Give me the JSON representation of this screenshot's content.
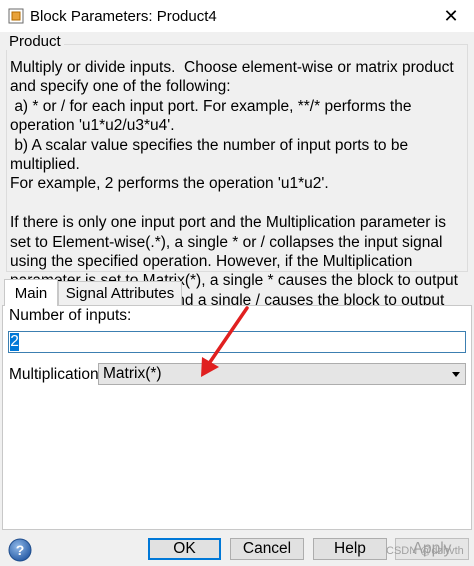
{
  "window": {
    "title": "Block Parameters: Product4",
    "close_glyph": "✕"
  },
  "group": {
    "title": "Product",
    "description": "Multiply or divide inputs.  Choose element-wise or matrix product and specify one of the following:\n a) * or / for each input port. For example, **/* performs the operation 'u1*u2/u3*u4'.\n b) A scalar value specifies the number of input ports to be multiplied.\nFor example, 2 performs the operation 'u1*u2'.\n\nIf there is only one input port and the Multiplication parameter is set to Element-wise(.*), a single * or / collapses the input signal using the specified operation. However, if the Multiplication parameter is set to Matrix(*), a single * causes the block to output the matrix unchanged, and a single / causes the block to output the matrix inverse."
  },
  "tabs": [
    {
      "label": "Main",
      "active": true
    },
    {
      "label": "Signal Attributes",
      "active": false
    }
  ],
  "main": {
    "num_inputs_label": "Number of inputs:",
    "num_inputs_value": "2",
    "multiplication_label": "Multiplication:",
    "multiplication_value": "Matrix(*)"
  },
  "buttons": {
    "ok": "OK",
    "cancel": "Cancel",
    "help": "Help",
    "apply": "Apply"
  },
  "watermark": "CSDN @dzhvth",
  "colors": {
    "annotation_arrow": "#e02020",
    "focus_border": "#0078d7"
  }
}
